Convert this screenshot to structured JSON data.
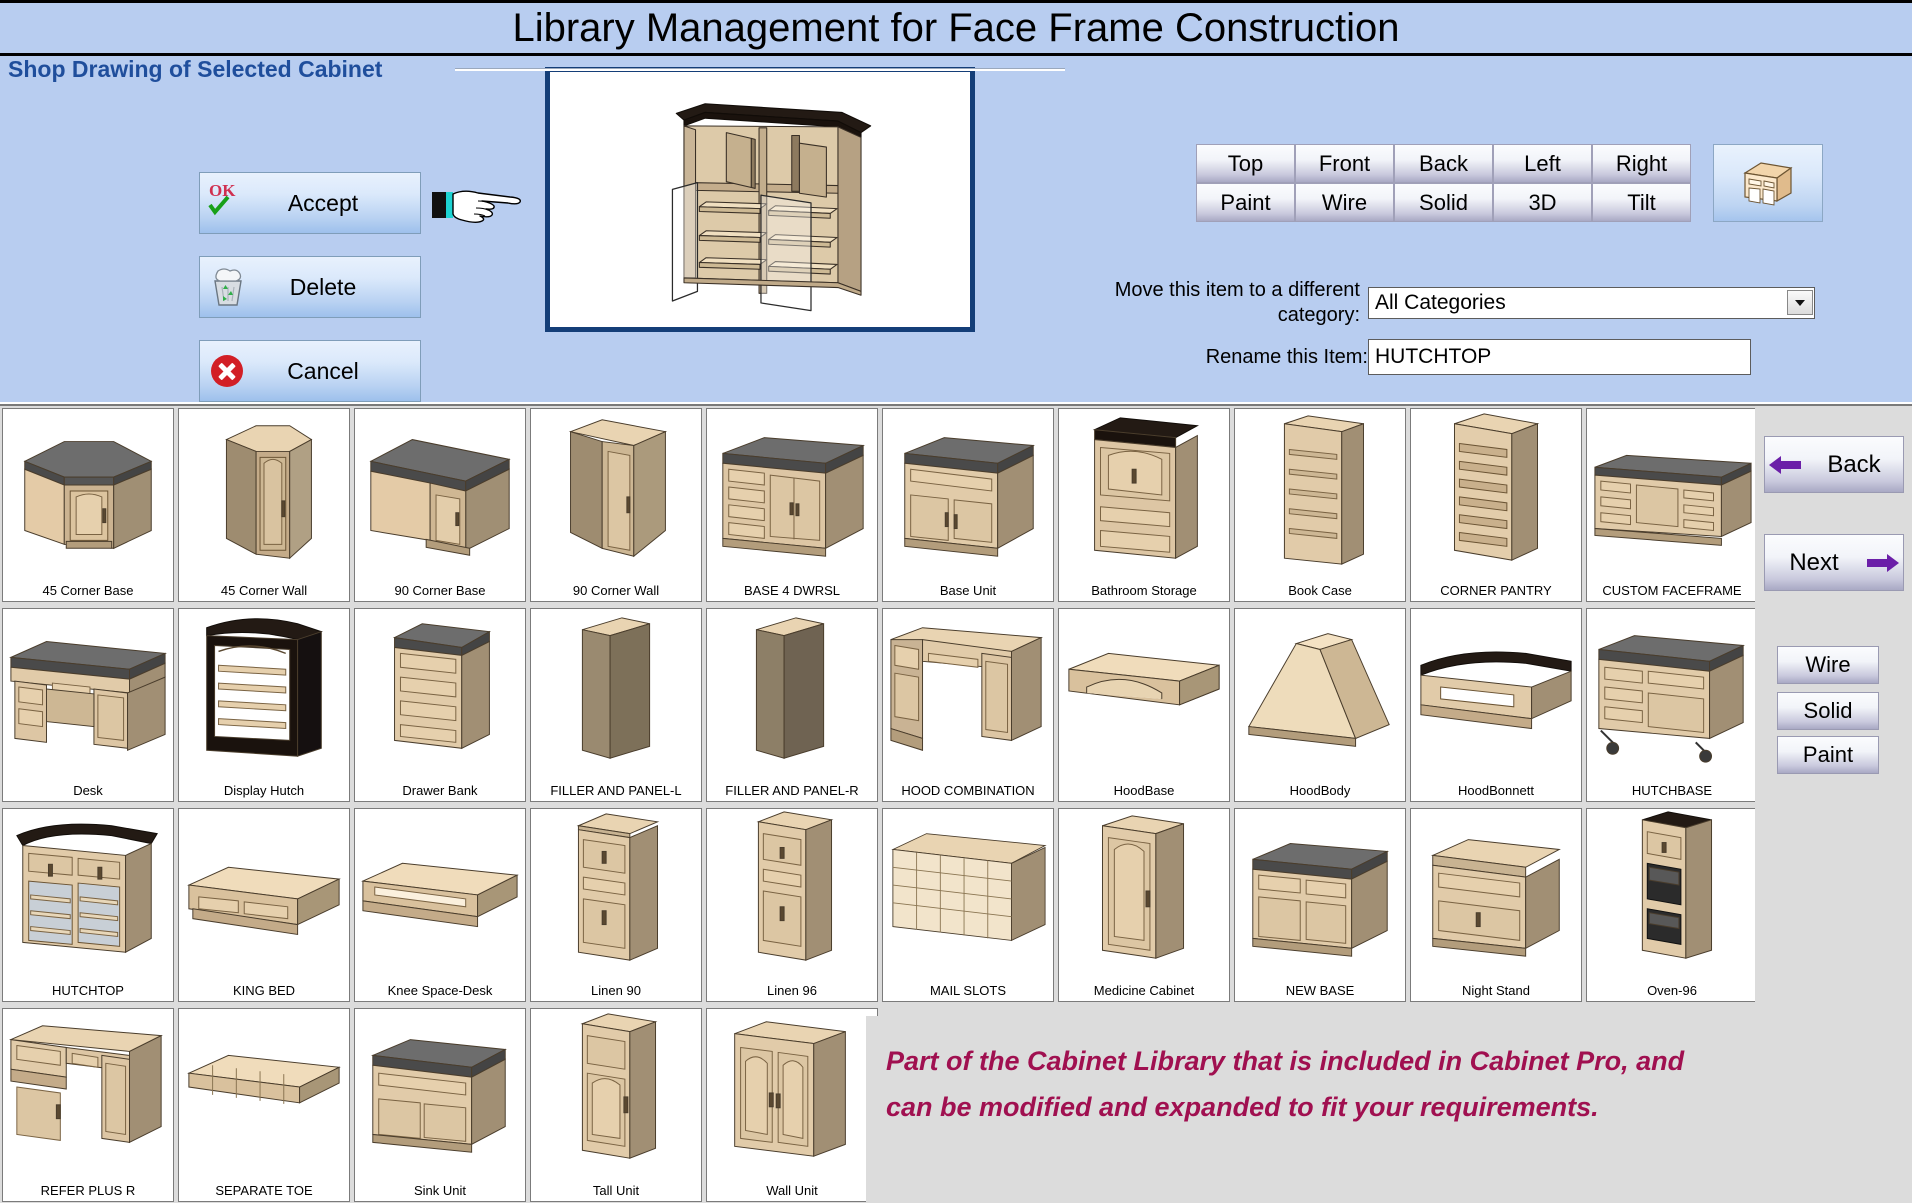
{
  "window": {
    "title": "Library Management for Face Frame Construction"
  },
  "shop_drawing": {
    "group_label": "Shop Drawing of Selected Cabinet"
  },
  "actions": [
    {
      "label": "Accept",
      "icon": "ok-check-icon"
    },
    {
      "label": "Delete",
      "icon": "recycle-bin-icon"
    },
    {
      "label": "Cancel",
      "icon": "red-x-circle-icon"
    }
  ],
  "view_buttons": {
    "row1": [
      "Top",
      "Front",
      "Back",
      "Left",
      "Right"
    ],
    "row2": [
      "Paint",
      "Wire",
      "Solid",
      "3D",
      "Tilt"
    ],
    "cube_icon": "cabinet-3d-icon"
  },
  "form": {
    "category_label_line1": "Move this item to a different",
    "category_label_line2": "category:",
    "category_value": "All Categories",
    "rename_label": "Rename this Item:",
    "rename_value": "HUTCHTOP"
  },
  "right_rail": {
    "back_label": "Back",
    "next_label": "Next",
    "mode_buttons": [
      "Wire",
      "Solid",
      "Paint"
    ]
  },
  "note": {
    "line1": "Part of the Cabinet Library that is included in Cabinet Pro, and",
    "line2": "can be modified and expanded to fit your requirements."
  },
  "library": {
    "rows": [
      [
        {
          "label": "45 Corner Base",
          "thumb": "corner-base"
        },
        {
          "label": "45 Corner Wall",
          "thumb": "corner-wall"
        },
        {
          "label": "90 Corner Base",
          "thumb": "corner-base-90"
        },
        {
          "label": "90 Corner Wall",
          "thumb": "corner-wall-90"
        },
        {
          "label": "BASE 4 DWRSL",
          "thumb": "base-drawers"
        },
        {
          "label": "Base Unit",
          "thumb": "base-unit"
        },
        {
          "label": "Bathroom Storage",
          "thumb": "bath-storage"
        },
        {
          "label": "Book Case",
          "thumb": "book-case"
        },
        {
          "label": "CORNER PANTRY",
          "thumb": "corner-pantry"
        },
        {
          "label": "CUSTOM FACEFRAME",
          "thumb": "custom-faceframe"
        }
      ],
      [
        {
          "label": "Desk",
          "thumb": "desk"
        },
        {
          "label": "Display Hutch",
          "thumb": "display-hutch"
        },
        {
          "label": "Drawer Bank",
          "thumb": "drawer-bank"
        },
        {
          "label": "FILLER AND PANEL-L",
          "thumb": "filler-panel-l"
        },
        {
          "label": "FILLER AND PANEL-R",
          "thumb": "filler-panel-r"
        },
        {
          "label": "HOOD COMBINATION",
          "thumb": "hood-combination"
        },
        {
          "label": "HoodBase",
          "thumb": "hood-base"
        },
        {
          "label": "HoodBody",
          "thumb": "hood-body"
        },
        {
          "label": "HoodBonnett",
          "thumb": "hood-bonnett"
        },
        {
          "label": "HUTCHBASE",
          "thumb": "hutch-base"
        }
      ],
      [
        {
          "label": "HUTCHTOP",
          "thumb": "hutch-top"
        },
        {
          "label": "KING BED",
          "thumb": "king-bed"
        },
        {
          "label": "Knee Space-Desk",
          "thumb": "knee-space-desk"
        },
        {
          "label": "Linen 90",
          "thumb": "linen-90"
        },
        {
          "label": "Linen 96",
          "thumb": "linen-96"
        },
        {
          "label": "MAIL SLOTS",
          "thumb": "mail-slots"
        },
        {
          "label": "Medicine Cabinet",
          "thumb": "medicine-cabinet"
        },
        {
          "label": "NEW BASE",
          "thumb": "new-base"
        },
        {
          "label": "Night Stand",
          "thumb": "night-stand"
        },
        {
          "label": "Oven-96",
          "thumb": "oven-96"
        }
      ],
      [
        {
          "label": "REFER PLUS R",
          "thumb": "refer-plus-r"
        },
        {
          "label": "SEPARATE TOE",
          "thumb": "separate-toe"
        },
        {
          "label": "Sink Unit",
          "thumb": "sink-unit"
        },
        {
          "label": "Tall Unit",
          "thumb": "tall-unit"
        },
        {
          "label": "Wall Unit",
          "thumb": "wall-unit"
        }
      ]
    ]
  },
  "colors": {
    "panel_blue": "#b8cdf0",
    "group_label_blue": "#1f4e9c",
    "note_magenta": "#a01050",
    "grid_gray": "#dcdcdc",
    "preview_border": "#143e78"
  }
}
